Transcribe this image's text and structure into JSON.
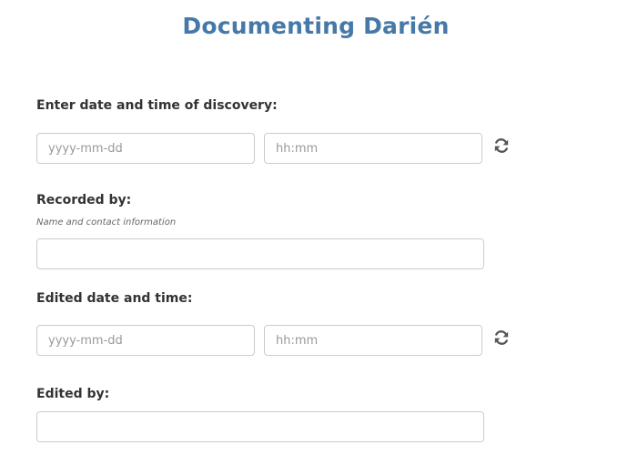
{
  "page": {
    "title": "Documenting Darién"
  },
  "discovery": {
    "label": "Enter date and time of discovery:",
    "date_placeholder": "yyyy-mm-dd",
    "date_value": "",
    "time_placeholder": "hh:mm",
    "time_value": "",
    "refresh_icon": "refresh-icon"
  },
  "recorded_by": {
    "label": "Recorded by:",
    "hint": "Name and contact information",
    "value": "",
    "placeholder": ""
  },
  "edited_datetime": {
    "label": "Edited date and time:",
    "date_placeholder": "yyyy-mm-dd",
    "date_value": "",
    "time_placeholder": "hh:mm",
    "time_value": "",
    "refresh_icon": "refresh-icon"
  },
  "edited_by": {
    "label": "Edited by:",
    "value": "",
    "placeholder": ""
  },
  "colors": {
    "title": "#4679a8",
    "label": "#333333",
    "border": "#cccccc",
    "icon": "#555555"
  }
}
